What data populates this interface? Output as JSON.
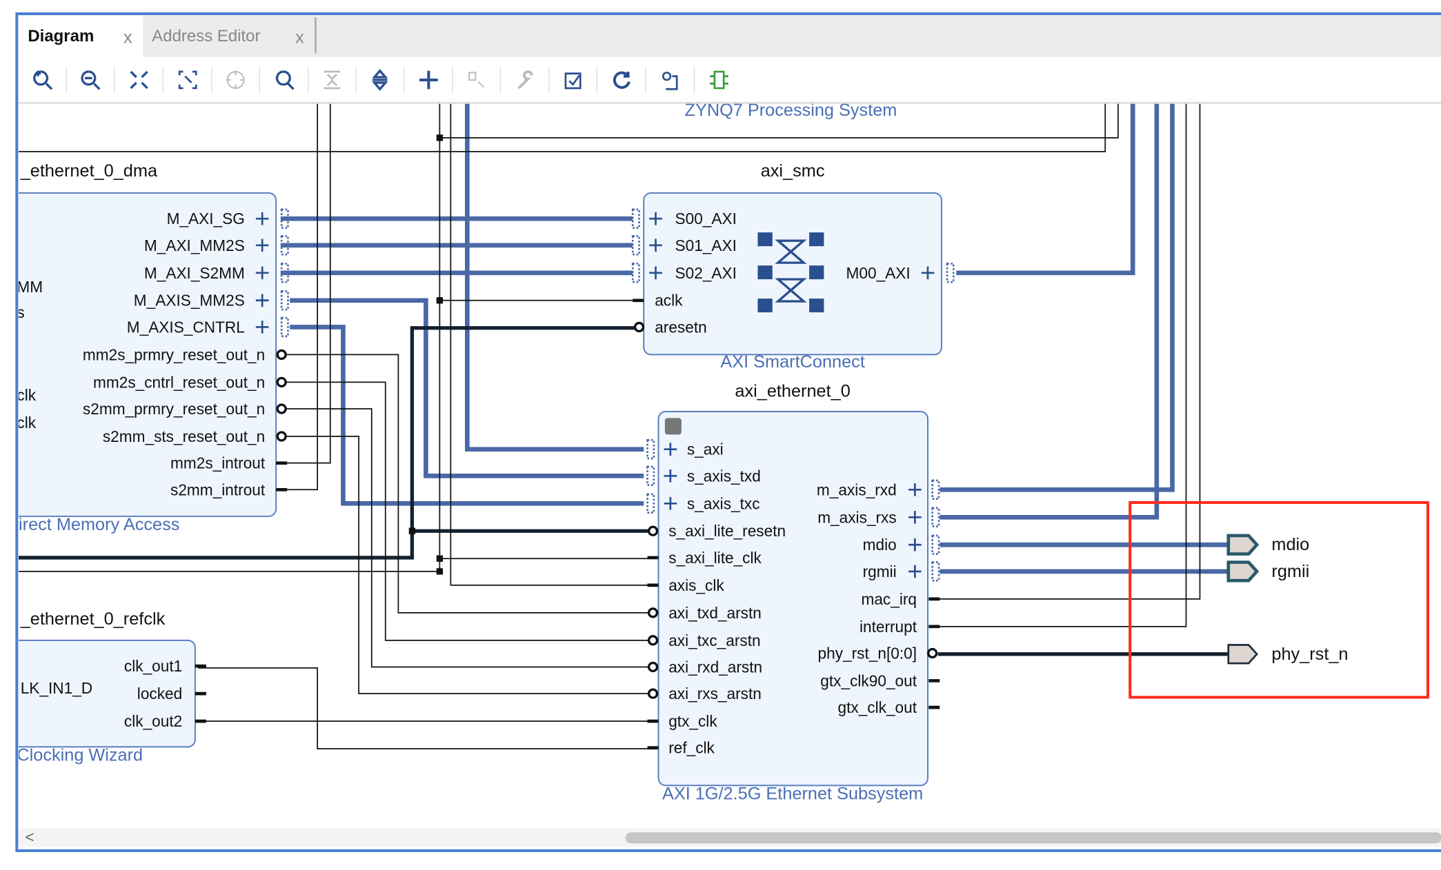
{
  "tabs": [
    {
      "label": "Diagram",
      "active": true,
      "close": "x"
    },
    {
      "label": "Address Editor",
      "active": false,
      "close": "x"
    }
  ],
  "toolbar": [
    "zoom-in-icon",
    "zoom-out-icon",
    "zoom-fit-icon",
    "zoom-selection-icon",
    "center-icon",
    "search-icon",
    "collapse-icon",
    "expand-icon",
    "add-ip-icon",
    "make-connection-icon",
    "properties-wrench-icon",
    "validate-design-icon",
    "regenerate-layout-icon",
    "optimize-routing-icon",
    "add-module-icon"
  ],
  "colors": {
    "accent": "#4a7fd0",
    "wire_bus": "#4a68a6",
    "block_fill": "#eef5fd",
    "highlight": "#ff2a1a",
    "port_fill": "#ddd6d0"
  },
  "zynq_label": "ZYNQ7 Processing System",
  "dma": {
    "title": "_ethernet_0_dma",
    "subtitle": "irect Memory Access",
    "left_partial": [
      "MM",
      "s",
      "clk",
      "clk"
    ],
    "ports": [
      "M_AXI_SG",
      "M_AXI_MM2S",
      "M_AXI_S2MM",
      "M_AXIS_MM2S",
      "M_AXIS_CNTRL",
      "mm2s_prmry_reset_out_n",
      "mm2s_cntrl_reset_out_n",
      "s2mm_prmry_reset_out_n",
      "s2mm_sts_reset_out_n",
      "mm2s_introut",
      "s2mm_introut"
    ]
  },
  "smc": {
    "title": "axi_smc",
    "subtitle": "AXI SmartConnect",
    "left_ports": [
      "S00_AXI",
      "S01_AXI",
      "S02_AXI",
      "aclk",
      "aresetn"
    ],
    "right_ports": [
      "M00_AXI"
    ]
  },
  "eth": {
    "title": "axi_ethernet_0",
    "subtitle": "AXI 1G/2.5G Ethernet Subsystem",
    "left_ports": [
      "s_axi",
      "s_axis_txd",
      "s_axis_txc",
      "s_axi_lite_resetn",
      "s_axi_lite_clk",
      "axis_clk",
      "axi_txd_arstn",
      "axi_txc_arstn",
      "axi_rxd_arstn",
      "axi_rxs_arstn",
      "gtx_clk",
      "ref_clk"
    ],
    "right_ports": [
      "m_axis_rxd",
      "m_axis_rxs",
      "mdio",
      "rgmii",
      "mac_irq",
      "interrupt",
      "phy_rst_n[0:0]",
      "gtx_clk90_out",
      "gtx_clk_out"
    ]
  },
  "clk": {
    "title": "_ethernet_0_refclk",
    "subtitle": "Clocking Wizard",
    "left_partial": "LK_IN1_D",
    "ports": [
      "clk_out1",
      "locked",
      "clk_out2"
    ]
  },
  "external_ports": [
    "mdio",
    "rgmii",
    "phy_rst_n"
  ],
  "scrollbar": {
    "left_arrow": "<"
  }
}
